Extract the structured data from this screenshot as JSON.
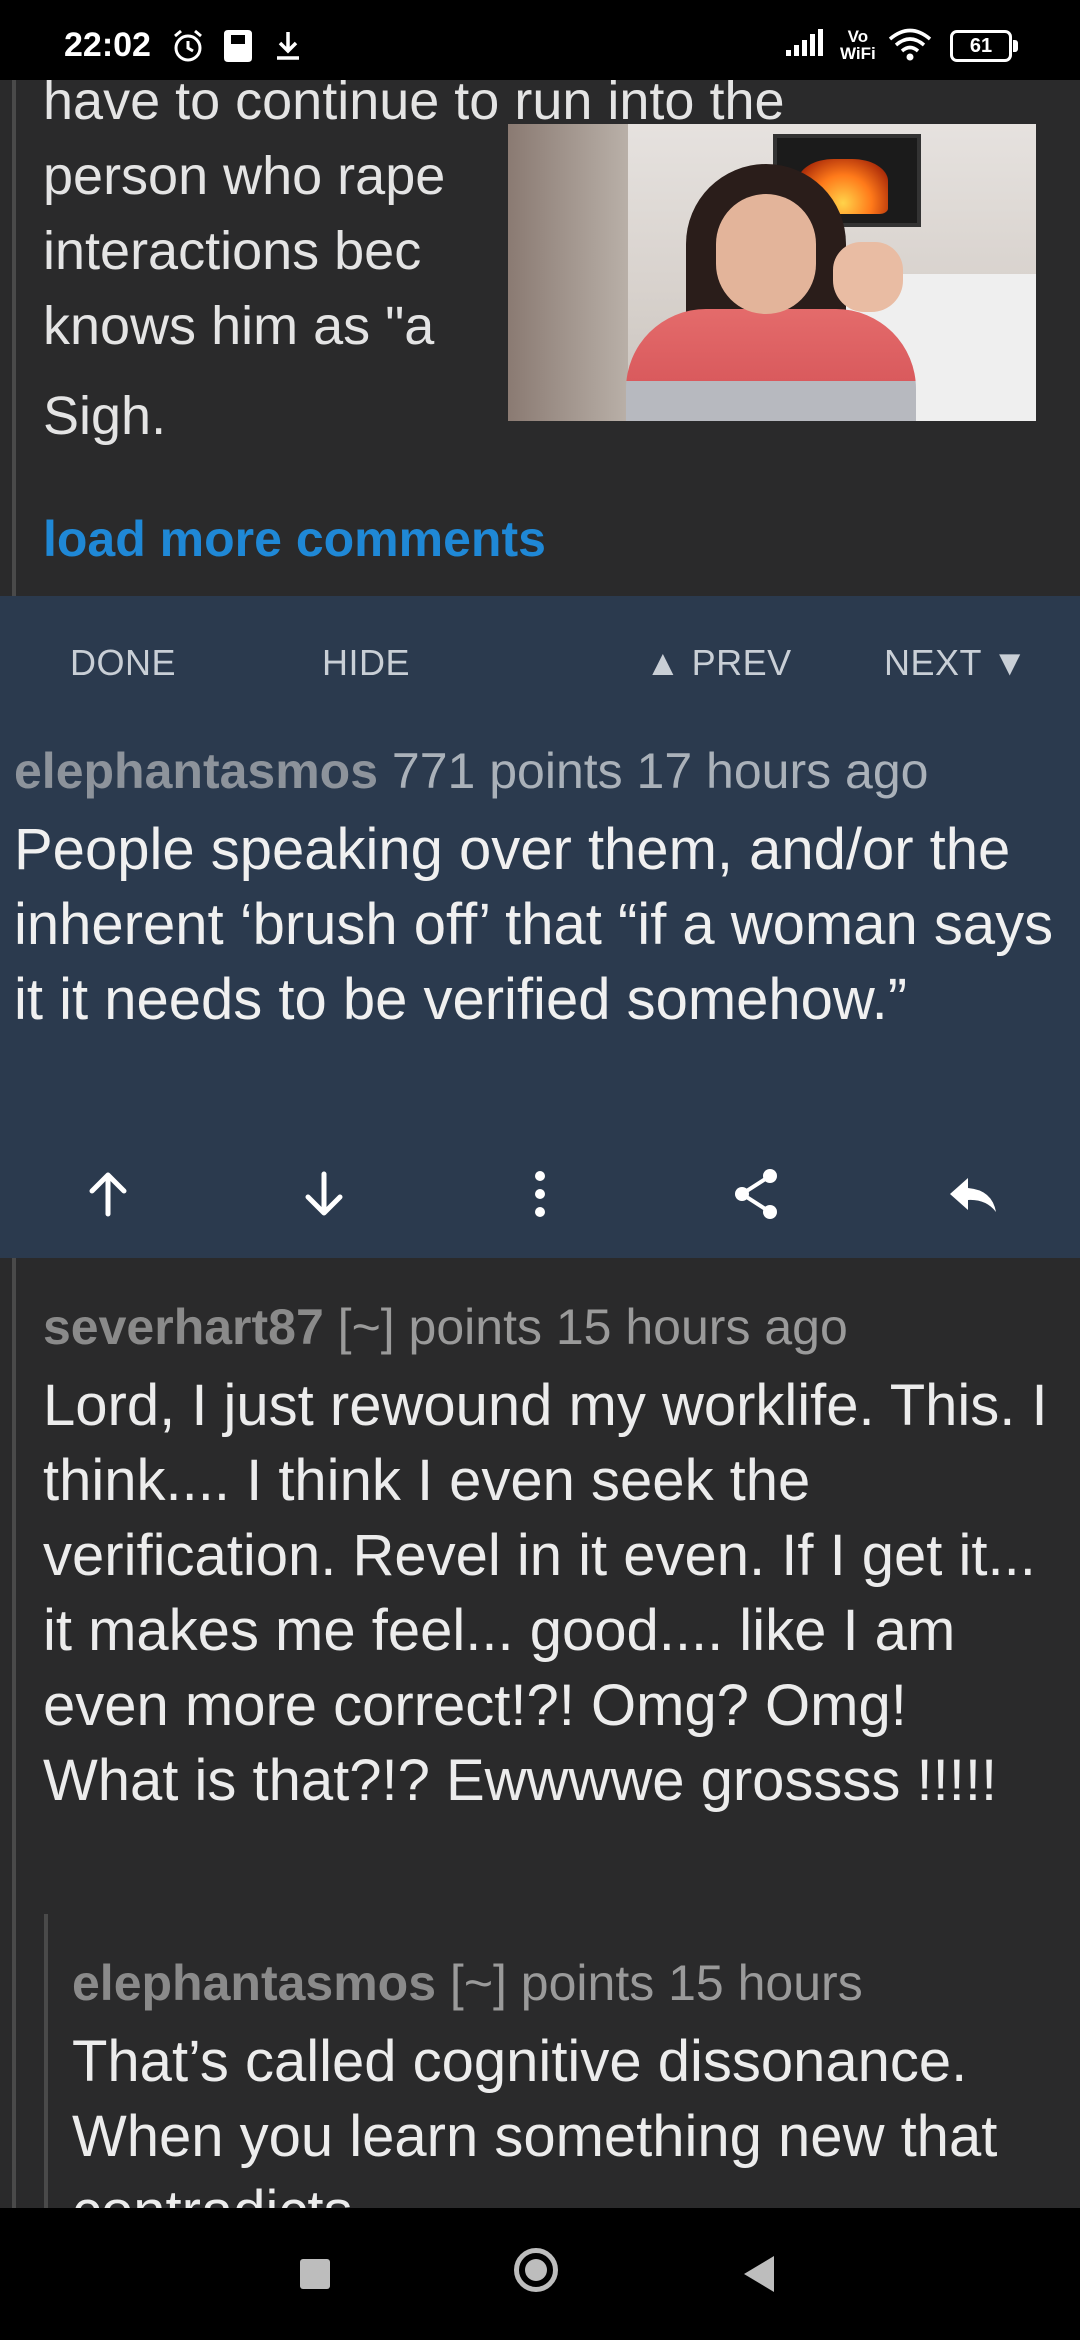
{
  "status_bar": {
    "time": "22:02",
    "vowifi_top": "Vo",
    "vowifi_bottom": "WiFi",
    "battery": "61"
  },
  "top_comment": {
    "lines": [
      "have to continue to run into the",
      "person who rape",
      "interactions bec",
      "knows him as \"a"
    ],
    "sigh": "Sigh.",
    "load_more": "load more comments"
  },
  "toolbar": {
    "done": "DONE",
    "hide": "HIDE",
    "prev": "▲ PREV",
    "next": "NEXT ▼"
  },
  "highlighted_comment": {
    "author": "elephantasmos",
    "meta": "771 points 17 hours ago",
    "body": "People speaking over them, and/or the inherent ‘brush off’ that “if a woman says it it needs to be verified somehow.”"
  },
  "comment": {
    "author": "severhart87",
    "meta": "[~] points 15 hours ago",
    "body": "Lord, I just rewound my worklife. This. I think.... I think I even seek the verification. Revel in it even. If I get it... it makes me feel... good.... like I am even more correct!?! Omg? Omg! What is that?!? Ewwwwe grossss !!!!!"
  },
  "reply": {
    "author": "elephantasmos",
    "meta": "[~] points 15 hours",
    "body": "That’s called cognitive dissonance. When you learn something new that contradicts"
  },
  "colors": {
    "accent_link": "#1f88d6",
    "highlight_bg": "#2b3a4e",
    "page_bg": "#2a2a2b"
  },
  "icons": [
    "alarm-icon",
    "sd-card-icon",
    "download-icon",
    "signal-icon",
    "wifi-icon",
    "battery-icon",
    "upvote-arrow-icon",
    "downvote-arrow-icon",
    "more-vert-icon",
    "share-icon",
    "reply-icon",
    "recent-apps-icon",
    "home-icon",
    "back-icon"
  ]
}
